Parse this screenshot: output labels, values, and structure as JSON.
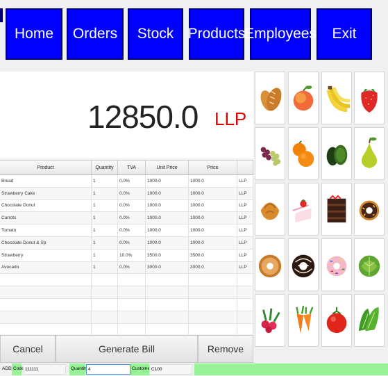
{
  "nav": [
    {
      "label": "Home",
      "name": "home-button"
    },
    {
      "label": "Orders",
      "name": "orders-button"
    },
    {
      "label": "Stock",
      "name": "stock-button"
    },
    {
      "label": "Products",
      "name": "products-button"
    },
    {
      "label": "Employees",
      "name": "employees-button"
    },
    {
      "label": "Exit",
      "name": "exit-button"
    }
  ],
  "total": {
    "amount": "12850.0",
    "currency": "LLP"
  },
  "table": {
    "headers": [
      "Product",
      "Quantity",
      "TVA",
      "Unit Price",
      "Price",
      ""
    ],
    "rows": [
      [
        "Bread",
        "1",
        "0.0%",
        "1000.0",
        "1000.0",
        "LLP"
      ],
      [
        "Strawberry Cake",
        "1",
        "0.0%",
        "1000.0",
        "1000.0",
        "LLP"
      ],
      [
        "Chocolate Donut",
        "1",
        "0.0%",
        "1000.0",
        "1000.0",
        "LLP"
      ],
      [
        "Carrots",
        "1",
        "0.0%",
        "1000.0",
        "1000.0",
        "LLP"
      ],
      [
        "Tomato",
        "1",
        "0.0%",
        "1000.0",
        "1000.0",
        "LLP"
      ],
      [
        "Chocolate Donut & Sp",
        "1",
        "0.0%",
        "1000.0",
        "1000.0",
        "LLP"
      ],
      [
        "Strawberry",
        "1",
        "10.0%",
        "3500.0",
        "3500.0",
        "LLP"
      ],
      [
        "Avocado",
        "1",
        "0.0%",
        "3000.0",
        "3000.0",
        "LLP"
      ]
    ],
    "empty_rows": 5
  },
  "actions": {
    "cancel": "Cancel",
    "generate": "Generate Bill",
    "remove": "Remove"
  },
  "status": {
    "mode": "ADD",
    "code_label": "Code",
    "code_value": "111111",
    "quantity_label": "Quantity",
    "quantity_value": "4",
    "customer_label": "Customer",
    "customer_value": "C100"
  },
  "products": [
    "bread-icon",
    "peach-icon",
    "banana-icon",
    "strawberry-icon",
    "grapes-icon",
    "orange-icon",
    "avocado-icon",
    "pear-icon",
    "croissant-icon",
    "strawberry-cake-icon",
    "chocolate-cake-icon",
    "chocolate-donut-icon",
    "glazed-donut-icon",
    "chocolate-sprinkle-donut-icon",
    "sprinkle-donut-icon",
    "cabbage-icon",
    "radish-icon",
    "carrot-icon",
    "tomato-icon",
    "lettuce-icon"
  ],
  "colors": {
    "nav_bg": "#0000ff",
    "currency": "#e00000",
    "status_green": "#98f398"
  }
}
